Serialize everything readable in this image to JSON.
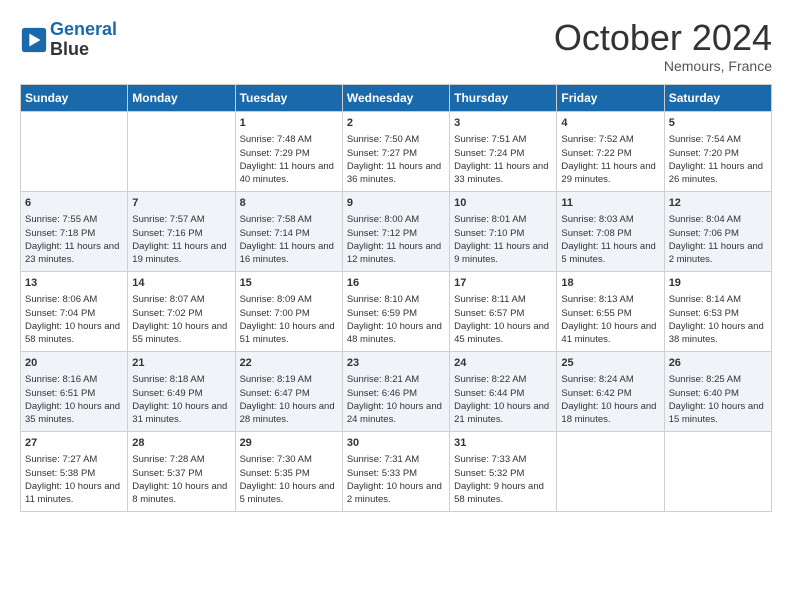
{
  "logo": {
    "line1": "General",
    "line2": "Blue",
    "icon_color": "#1a6aab"
  },
  "header": {
    "month": "October 2024",
    "location": "Nemours, France"
  },
  "days_of_week": [
    "Sunday",
    "Monday",
    "Tuesday",
    "Wednesday",
    "Thursday",
    "Friday",
    "Saturday"
  ],
  "weeks": [
    [
      {
        "day": "",
        "content": ""
      },
      {
        "day": "",
        "content": ""
      },
      {
        "day": "1",
        "content": "Sunrise: 7:48 AM\nSunset: 7:29 PM\nDaylight: 11 hours and 40 minutes."
      },
      {
        "day": "2",
        "content": "Sunrise: 7:50 AM\nSunset: 7:27 PM\nDaylight: 11 hours and 36 minutes."
      },
      {
        "day": "3",
        "content": "Sunrise: 7:51 AM\nSunset: 7:24 PM\nDaylight: 11 hours and 33 minutes."
      },
      {
        "day": "4",
        "content": "Sunrise: 7:52 AM\nSunset: 7:22 PM\nDaylight: 11 hours and 29 minutes."
      },
      {
        "day": "5",
        "content": "Sunrise: 7:54 AM\nSunset: 7:20 PM\nDaylight: 11 hours and 26 minutes."
      }
    ],
    [
      {
        "day": "6",
        "content": "Sunrise: 7:55 AM\nSunset: 7:18 PM\nDaylight: 11 hours and 23 minutes."
      },
      {
        "day": "7",
        "content": "Sunrise: 7:57 AM\nSunset: 7:16 PM\nDaylight: 11 hours and 19 minutes."
      },
      {
        "day": "8",
        "content": "Sunrise: 7:58 AM\nSunset: 7:14 PM\nDaylight: 11 hours and 16 minutes."
      },
      {
        "day": "9",
        "content": "Sunrise: 8:00 AM\nSunset: 7:12 PM\nDaylight: 11 hours and 12 minutes."
      },
      {
        "day": "10",
        "content": "Sunrise: 8:01 AM\nSunset: 7:10 PM\nDaylight: 11 hours and 9 minutes."
      },
      {
        "day": "11",
        "content": "Sunrise: 8:03 AM\nSunset: 7:08 PM\nDaylight: 11 hours and 5 minutes."
      },
      {
        "day": "12",
        "content": "Sunrise: 8:04 AM\nSunset: 7:06 PM\nDaylight: 11 hours and 2 minutes."
      }
    ],
    [
      {
        "day": "13",
        "content": "Sunrise: 8:06 AM\nSunset: 7:04 PM\nDaylight: 10 hours and 58 minutes."
      },
      {
        "day": "14",
        "content": "Sunrise: 8:07 AM\nSunset: 7:02 PM\nDaylight: 10 hours and 55 minutes."
      },
      {
        "day": "15",
        "content": "Sunrise: 8:09 AM\nSunset: 7:00 PM\nDaylight: 10 hours and 51 minutes."
      },
      {
        "day": "16",
        "content": "Sunrise: 8:10 AM\nSunset: 6:59 PM\nDaylight: 10 hours and 48 minutes."
      },
      {
        "day": "17",
        "content": "Sunrise: 8:11 AM\nSunset: 6:57 PM\nDaylight: 10 hours and 45 minutes."
      },
      {
        "day": "18",
        "content": "Sunrise: 8:13 AM\nSunset: 6:55 PM\nDaylight: 10 hours and 41 minutes."
      },
      {
        "day": "19",
        "content": "Sunrise: 8:14 AM\nSunset: 6:53 PM\nDaylight: 10 hours and 38 minutes."
      }
    ],
    [
      {
        "day": "20",
        "content": "Sunrise: 8:16 AM\nSunset: 6:51 PM\nDaylight: 10 hours and 35 minutes."
      },
      {
        "day": "21",
        "content": "Sunrise: 8:18 AM\nSunset: 6:49 PM\nDaylight: 10 hours and 31 minutes."
      },
      {
        "day": "22",
        "content": "Sunrise: 8:19 AM\nSunset: 6:47 PM\nDaylight: 10 hours and 28 minutes."
      },
      {
        "day": "23",
        "content": "Sunrise: 8:21 AM\nSunset: 6:46 PM\nDaylight: 10 hours and 24 minutes."
      },
      {
        "day": "24",
        "content": "Sunrise: 8:22 AM\nSunset: 6:44 PM\nDaylight: 10 hours and 21 minutes."
      },
      {
        "day": "25",
        "content": "Sunrise: 8:24 AM\nSunset: 6:42 PM\nDaylight: 10 hours and 18 minutes."
      },
      {
        "day": "26",
        "content": "Sunrise: 8:25 AM\nSunset: 6:40 PM\nDaylight: 10 hours and 15 minutes."
      }
    ],
    [
      {
        "day": "27",
        "content": "Sunrise: 7:27 AM\nSunset: 5:38 PM\nDaylight: 10 hours and 11 minutes."
      },
      {
        "day": "28",
        "content": "Sunrise: 7:28 AM\nSunset: 5:37 PM\nDaylight: 10 hours and 8 minutes."
      },
      {
        "day": "29",
        "content": "Sunrise: 7:30 AM\nSunset: 5:35 PM\nDaylight: 10 hours and 5 minutes."
      },
      {
        "day": "30",
        "content": "Sunrise: 7:31 AM\nSunset: 5:33 PM\nDaylight: 10 hours and 2 minutes."
      },
      {
        "day": "31",
        "content": "Sunrise: 7:33 AM\nSunset: 5:32 PM\nDaylight: 9 hours and 58 minutes."
      },
      {
        "day": "",
        "content": ""
      },
      {
        "day": "",
        "content": ""
      }
    ]
  ]
}
